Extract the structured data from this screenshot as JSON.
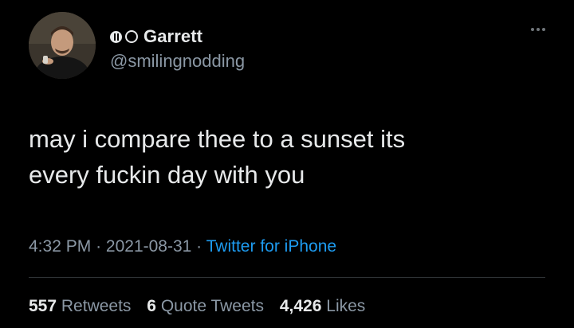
{
  "tweet": {
    "author": {
      "display_name": "Garrett",
      "handle": "@smilingnodding"
    },
    "text_line1": "may i compare thee to a sunset its",
    "text_line2": "every fuckin day with you",
    "time": "4:32 PM",
    "separator": "·",
    "date": "2021-08-31",
    "source": "Twitter for iPhone",
    "stats": {
      "retweets_count": "557",
      "retweets_label": "Retweets",
      "quotes_count": "6",
      "quotes_label": "Quote Tweets",
      "likes_count": "4,426",
      "likes_label": "Likes"
    }
  },
  "icons": {
    "more": "more-options-icon"
  },
  "colors": {
    "background": "#000000",
    "text_primary": "#e7e9ea",
    "text_secondary": "#8b98a5",
    "link": "#1d9bf0",
    "divider": "#2f3336"
  }
}
